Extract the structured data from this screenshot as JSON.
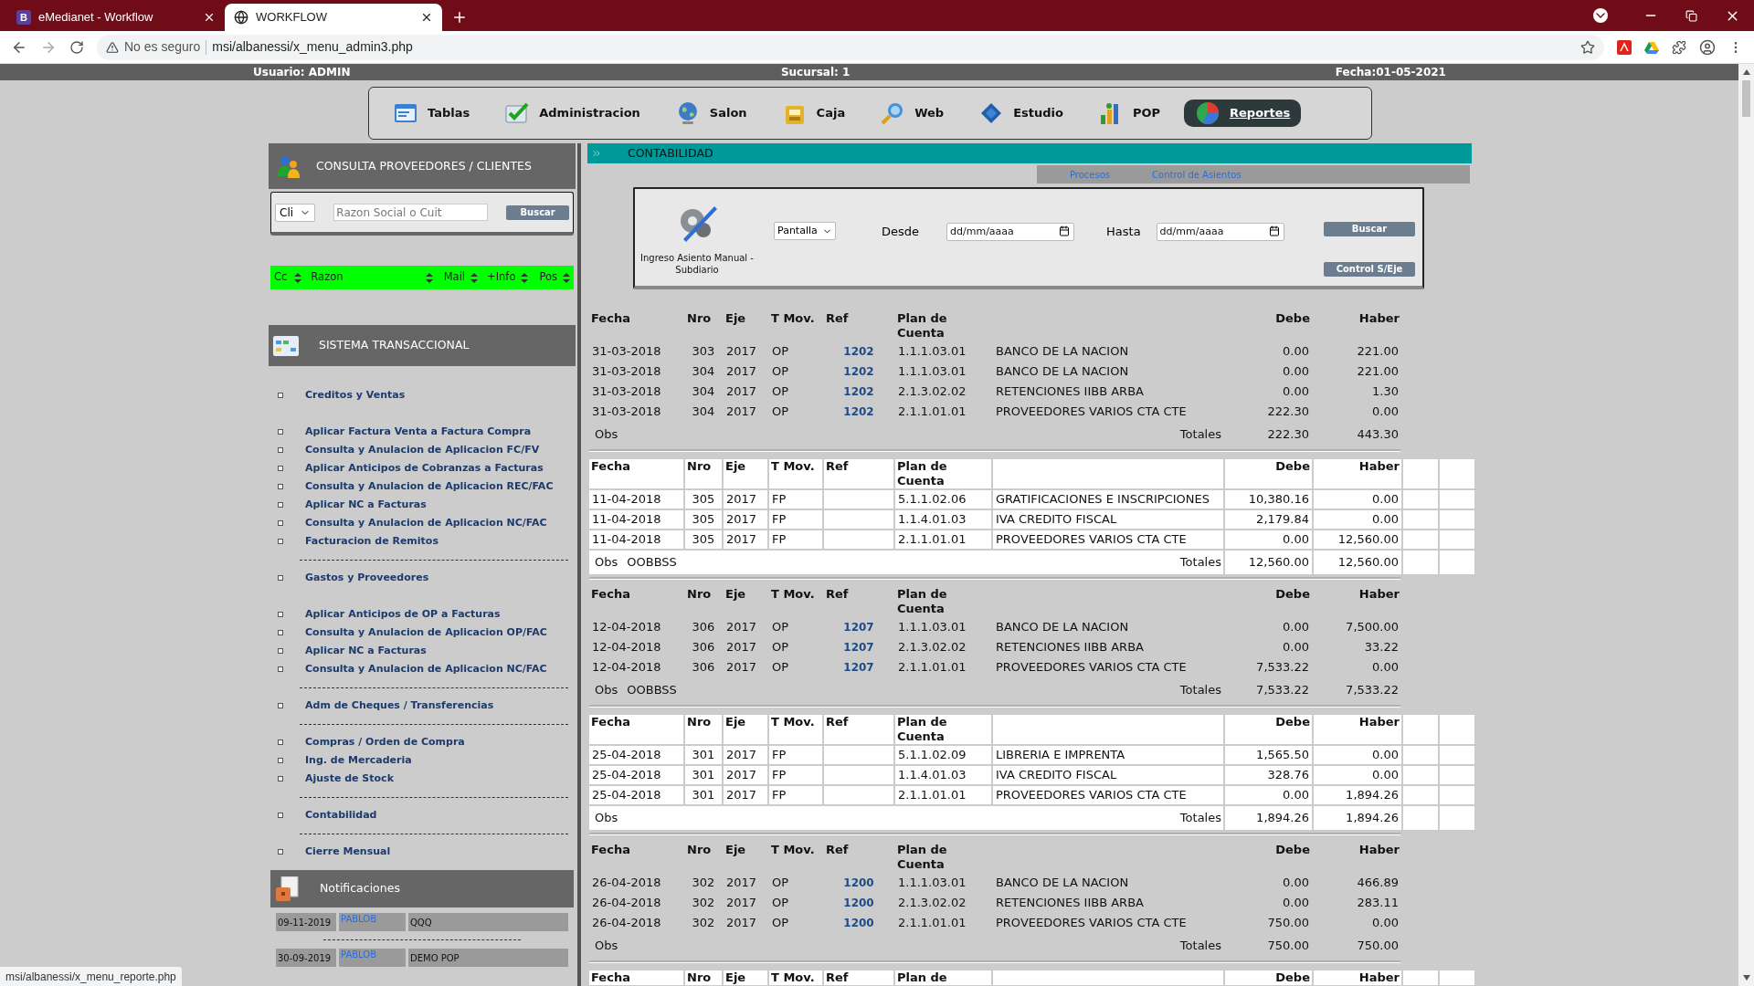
{
  "browser": {
    "tabs": [
      {
        "favicon": "B",
        "title": "eMedianet - Workflow",
        "selected": false
      },
      {
        "title": "WORKFLOW",
        "selected": true
      }
    ],
    "security": "No es seguro",
    "url": "msi/albanessi/x_menu_admin3.php"
  },
  "info_bar": {
    "user": "Usuario: ADMIN",
    "branch": "Sucursal: 1",
    "date": "Fecha:01-05-2021"
  },
  "nav": [
    {
      "label": "Tablas",
      "selected": false
    },
    {
      "label": "Administracion",
      "selected": false
    },
    {
      "label": "Salon",
      "selected": false
    },
    {
      "label": "Caja",
      "selected": false
    },
    {
      "label": "Web",
      "selected": false
    },
    {
      "label": "Estudio",
      "selected": false
    },
    {
      "label": "POP",
      "selected": false
    },
    {
      "label": "Reportes",
      "selected": true
    }
  ],
  "sidebar": {
    "search_panel": {
      "title": "CONSULTA PROVEEDORES / CLIENTES",
      "type_select": "Cli",
      "placeholder": "Razon Social o Cuit",
      "button": "Buscar",
      "columns": [
        "Cc",
        "Razon",
        "Mail",
        "+Info",
        "Pos"
      ]
    },
    "menu_title": "SISTEMA TRANSACCIONAL",
    "menu": [
      {
        "kind": "heading",
        "label": "Creditos y Ventas"
      },
      {
        "kind": "link",
        "label": "Aplicar Factura Venta a Factura Compra"
      },
      {
        "kind": "link",
        "label": "Consulta y Anulacion de Aplicacion FC/FV"
      },
      {
        "kind": "link",
        "label": "Aplicar Anticipos de Cobranzas a Facturas"
      },
      {
        "kind": "link",
        "label": "Consulta y Anulacion de Aplicacion REC/FAC"
      },
      {
        "kind": "link",
        "label": "Aplicar NC a Facturas"
      },
      {
        "kind": "link",
        "label": "Consulta y Anulacion de Aplicacion NC/FAC"
      },
      {
        "kind": "link",
        "label": "Facturacion de Remitos"
      },
      {
        "kind": "separator"
      },
      {
        "kind": "heading",
        "label": "Gastos y Proveedores"
      },
      {
        "kind": "link",
        "label": "Aplicar Anticipos de OP a Facturas"
      },
      {
        "kind": "link",
        "label": "Consulta y Anulacion de Aplicacion OP/FAC"
      },
      {
        "kind": "link",
        "label": "Aplicar NC a Facturas"
      },
      {
        "kind": "link",
        "label": "Consulta y Anulacion de Aplicacion NC/FAC"
      },
      {
        "kind": "separator"
      },
      {
        "kind": "link",
        "label": "Adm de Cheques / Transferencias"
      },
      {
        "kind": "separator"
      },
      {
        "kind": "link",
        "label": "Compras / Orden de Compra"
      },
      {
        "kind": "link",
        "label": "Ing. de Mercaderia"
      },
      {
        "kind": "link",
        "label": "Ajuste de Stock"
      },
      {
        "kind": "separator"
      },
      {
        "kind": "link",
        "label": "Contabilidad"
      },
      {
        "kind": "separator"
      },
      {
        "kind": "link",
        "label": "Cierre Mensual"
      }
    ],
    "notifications_title": "Notificaciones",
    "notifications": [
      {
        "date": "09-11-2019",
        "user": "PABLOB",
        "message": "QQQ"
      },
      {
        "date": "30-09-2019",
        "user": "PABLOB",
        "message": "DEMO POP"
      }
    ]
  },
  "main": {
    "title": "CONTABILIDAD",
    "subnav": [
      "Procesos",
      "Control de Asientos"
    ],
    "filter": {
      "caption": "Ingreso Asiento Manual - Subdiario",
      "output": "Pantalla",
      "from_label": "Desde",
      "from_placeholder": "dd/mm/aaaa",
      "to_label": "Hasta",
      "to_placeholder": "dd/mm/aaaa",
      "search_button": "Buscar",
      "control_button": "Control S/Eje"
    },
    "entries": [
      {
        "highlighted": false,
        "columns": [
          "Fecha",
          "Nro",
          "Eje",
          "T Mov.",
          "Ref",
          "Plan de Cuenta",
          "Debe",
          "Haber"
        ],
        "rows": [
          {
            "fecha": "31-03-2018",
            "nro": "303",
            "eje": "2017",
            "tmov": "OP",
            "ref": "1202",
            "plan": "1.1.1.03.01",
            "cuenta": "BANCO DE LA NACION",
            "debe": "0.00",
            "haber": "221.00"
          },
          {
            "fecha": "31-03-2018",
            "nro": "304",
            "eje": "2017",
            "tmov": "OP",
            "ref": "1202",
            "plan": "1.1.1.03.01",
            "cuenta": "BANCO DE LA NACION",
            "debe": "0.00",
            "haber": "221.00"
          },
          {
            "fecha": "31-03-2018",
            "nro": "304",
            "eje": "2017",
            "tmov": "OP",
            "ref": "1202",
            "plan": "2.1.3.02.02",
            "cuenta": "RETENCIONES IIBB ARBA",
            "debe": "0.00",
            "haber": "1.30"
          },
          {
            "fecha": "31-03-2018",
            "nro": "304",
            "eje": "2017",
            "tmov": "OP",
            "ref": "1202",
            "plan": "2.1.1.01.01",
            "cuenta": "PROVEEDORES VARIOS CTA CTE",
            "debe": "222.30",
            "haber": "0.00"
          }
        ],
        "obs_label": "Obs",
        "totals_label": "Totales",
        "total_debe": "222.30",
        "total_haber": "443.30"
      },
      {
        "highlighted": true,
        "columns": [
          "Fecha",
          "Nro",
          "Eje",
          "T Mov.",
          "Ref",
          "Plan de Cuenta",
          "Debe",
          "Haber"
        ],
        "rows": [
          {
            "fecha": "11-04-2018",
            "nro": "305",
            "eje": "2017",
            "tmov": "FP",
            "plan": "5.1.1.02.06",
            "cuenta": "GRATIFICACIONES E INSCRIPCIONES",
            "debe": "10,380.16",
            "haber": "0.00"
          },
          {
            "fecha": "11-04-2018",
            "nro": "305",
            "eje": "2017",
            "tmov": "FP",
            "plan": "1.1.4.01.03",
            "cuenta": "IVA CREDITO FISCAL",
            "debe": "2,179.84",
            "haber": "0.00"
          },
          {
            "fecha": "11-04-2018",
            "nro": "305",
            "eje": "2017",
            "tmov": "FP",
            "plan": "2.1.1.01.01",
            "cuenta": "PROVEEDORES VARIOS CTA CTE",
            "debe": "0.00",
            "haber": "12,560.00"
          }
        ],
        "obs_label": "Obs",
        "obs": "OOBBSS",
        "totals_label": "Totales",
        "total_debe": "12,560.00",
        "total_haber": "12,560.00"
      },
      {
        "highlighted": false,
        "columns": [
          "Fecha",
          "Nro",
          "Eje",
          "T Mov.",
          "Ref",
          "Plan de Cuenta",
          "Debe",
          "Haber"
        ],
        "rows": [
          {
            "fecha": "12-04-2018",
            "nro": "306",
            "eje": "2017",
            "tmov": "OP",
            "ref": "1207",
            "plan": "1.1.1.03.01",
            "cuenta": "BANCO DE LA NACION",
            "debe": "0.00",
            "haber": "7,500.00"
          },
          {
            "fecha": "12-04-2018",
            "nro": "306",
            "eje": "2017",
            "tmov": "OP",
            "ref": "1207",
            "plan": "2.1.3.02.02",
            "cuenta": "RETENCIONES IIBB ARBA",
            "debe": "0.00",
            "haber": "33.22"
          },
          {
            "fecha": "12-04-2018",
            "nro": "306",
            "eje": "2017",
            "tmov": "OP",
            "ref": "1207",
            "plan": "2.1.1.01.01",
            "cuenta": "PROVEEDORES VARIOS CTA CTE",
            "debe": "7,533.22",
            "haber": "0.00"
          }
        ],
        "obs_label": "Obs",
        "obs": "OOBBSS",
        "totals_label": "Totales",
        "total_debe": "7,533.22",
        "total_haber": "7,533.22"
      },
      {
        "highlighted": true,
        "columns": [
          "Fecha",
          "Nro",
          "Eje",
          "T Mov.",
          "Ref",
          "Plan de Cuenta",
          "Debe",
          "Haber"
        ],
        "rows": [
          {
            "fecha": "25-04-2018",
            "nro": "301",
            "eje": "2017",
            "tmov": "FP",
            "plan": "5.1.1.02.09",
            "cuenta": "LIBRERIA E IMPRENTA",
            "debe": "1,565.50",
            "haber": "0.00"
          },
          {
            "fecha": "25-04-2018",
            "nro": "301",
            "eje": "2017",
            "tmov": "FP",
            "plan": "1.1.4.01.03",
            "cuenta": "IVA CREDITO FISCAL",
            "debe": "328.76",
            "haber": "0.00"
          },
          {
            "fecha": "25-04-2018",
            "nro": "301",
            "eje": "2017",
            "tmov": "FP",
            "plan": "2.1.1.01.01",
            "cuenta": "PROVEEDORES VARIOS CTA CTE",
            "debe": "0.00",
            "haber": "1,894.26"
          }
        ],
        "obs_label": "Obs",
        "totals_label": "Totales",
        "total_debe": "1,894.26",
        "total_haber": "1,894.26"
      },
      {
        "highlighted": false,
        "columns": [
          "Fecha",
          "Nro",
          "Eje",
          "T Mov.",
          "Ref",
          "Plan de Cuenta",
          "Debe",
          "Haber"
        ],
        "rows": [
          {
            "fecha": "26-04-2018",
            "nro": "302",
            "eje": "2017",
            "tmov": "OP",
            "ref": "1200",
            "plan": "1.1.1.03.01",
            "cuenta": "BANCO DE LA NACION",
            "debe": "0.00",
            "haber": "466.89"
          },
          {
            "fecha": "26-04-2018",
            "nro": "302",
            "eje": "2017",
            "tmov": "OP",
            "ref": "1200",
            "plan": "2.1.3.02.02",
            "cuenta": "RETENCIONES IIBB ARBA",
            "debe": "0.00",
            "haber": "283.11"
          },
          {
            "fecha": "26-04-2018",
            "nro": "302",
            "eje": "2017",
            "tmov": "OP",
            "ref": "1200",
            "plan": "2.1.1.01.01",
            "cuenta": "PROVEEDORES VARIOS CTA CTE",
            "debe": "750.00",
            "haber": "0.00"
          }
        ],
        "obs_label": "Obs",
        "totals_label": "Totales",
        "total_debe": "750.00",
        "total_haber": "750.00"
      },
      {
        "highlighted": true,
        "columns": [
          "Fecha",
          "Nro",
          "Eje",
          "T Mov.",
          "Ref",
          "Plan de",
          "Debe",
          "Haber"
        ]
      }
    ]
  },
  "status_url": "msi/albanessi/x_menu_reporte.php"
}
